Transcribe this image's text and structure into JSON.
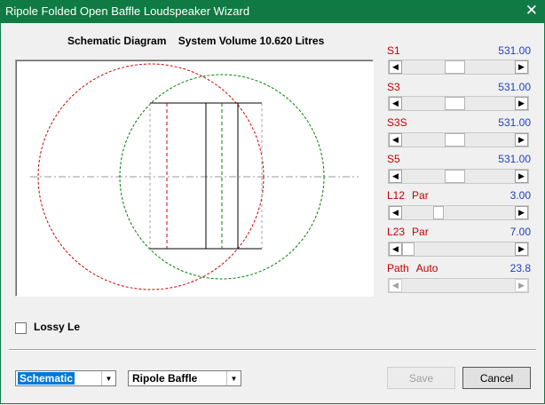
{
  "window": {
    "title": "Ripole Folded Open Baffle Loudspeaker Wizard",
    "close_glyph": "✕"
  },
  "diagram": {
    "label": "Schematic Diagram",
    "volume_text": "System Volume 10.620 Litres"
  },
  "params": [
    {
      "label": "S1",
      "sub": "",
      "value": "531.00",
      "thumb_pos": 0.5,
      "enabled": true
    },
    {
      "label": "S3",
      "sub": "",
      "value": "531.00",
      "thumb_pos": 0.5,
      "enabled": true
    },
    {
      "label": "S3S",
      "sub": "",
      "value": "531.00",
      "thumb_pos": 0.5,
      "enabled": true
    },
    {
      "label": "S5",
      "sub": "",
      "value": "531.00",
      "thumb_pos": 0.5,
      "enabled": true
    },
    {
      "label": "L12",
      "sub": "Par",
      "value": "3.00",
      "thumb_pos": 0.3,
      "enabled": true
    },
    {
      "label": "L23",
      "sub": "Par",
      "value": "7.00",
      "thumb_pos": 0.0,
      "enabled": true
    },
    {
      "label": "Path",
      "sub": "Auto",
      "value": "23.8",
      "thumb_pos": 0.0,
      "enabled": false
    }
  ],
  "lossy": {
    "label": "Lossy Le",
    "checked": false
  },
  "view_combo": {
    "selected": "Schematic"
  },
  "type_combo": {
    "selected": "Ripole Baffle"
  },
  "buttons": {
    "save": "Save",
    "cancel": "Cancel"
  },
  "colors": {
    "title_bar": "#0f7a43",
    "param_label": "#c00000",
    "param_value": "#1f3fbf",
    "red_circle": "#d00000",
    "green_circle": "#008000"
  }
}
